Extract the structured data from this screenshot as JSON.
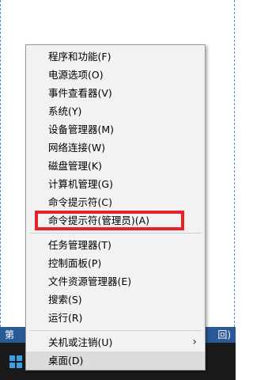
{
  "background_strip": {
    "left_text": "第",
    "right_text": "回)"
  },
  "menu": {
    "items": [
      {
        "label": "程序和功能(F)"
      },
      {
        "label": "电源选项(O)"
      },
      {
        "label": "事件查看器(V)"
      },
      {
        "label": "系统(Y)"
      },
      {
        "label": "设备管理器(M)"
      },
      {
        "label": "网络连接(W)"
      },
      {
        "label": "磁盘管理(K)"
      },
      {
        "label": "计算机管理(G)"
      },
      {
        "label": "命令提示符(C)"
      },
      {
        "label": "命令提示符(管理员)(A)"
      },
      {
        "label": "任务管理器(T)"
      },
      {
        "label": "控制面板(P)"
      },
      {
        "label": "文件资源管理器(E)"
      },
      {
        "label": "搜索(S)"
      },
      {
        "label": "运行(R)"
      },
      {
        "label": "关机或注销(U)"
      },
      {
        "label": "桌面(D)"
      }
    ],
    "submenu_arrow": "›"
  },
  "annotation": {
    "highlight_color": "#e8202a",
    "highlighted_item": "命令提示符(管理员)(A)"
  },
  "icons": {
    "start": "windows-logo-icon",
    "submenu": "chevron-right-icon"
  }
}
